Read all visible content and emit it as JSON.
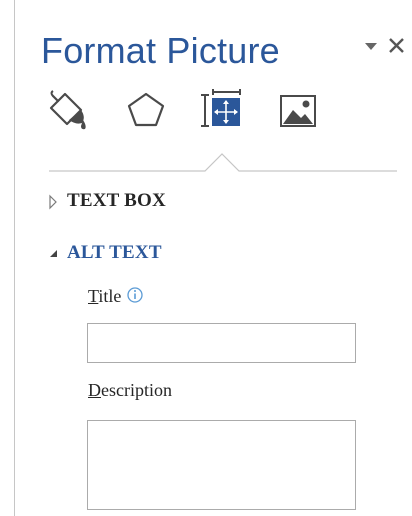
{
  "pane": {
    "title": "Format Picture",
    "dropdown_icon": "dropdown-triangle-icon",
    "close_icon": "close-icon"
  },
  "tabs": [
    {
      "icon": "fill-line-paint-bucket-icon",
      "selected": false
    },
    {
      "icon": "effects-pentagon-icon",
      "selected": false
    },
    {
      "icon": "size-properties-icon",
      "selected": true
    },
    {
      "icon": "picture-icon",
      "selected": false
    }
  ],
  "sections": {
    "text_box": {
      "label": "TEXT BOX",
      "expanded": false
    },
    "alt_text": {
      "label": "ALT TEXT",
      "expanded": true,
      "title_label_first": "T",
      "title_label_rest": "itle",
      "title_value": "",
      "description_label_first": "D",
      "description_label_rest": "escription",
      "description_value": ""
    }
  },
  "colors": {
    "accent": "#2b579a",
    "icon_gray": "#4a4a4a",
    "divider": "#c6c6c6",
    "expanded_header": "#2b579a",
    "collapsed_header": "#262626"
  }
}
